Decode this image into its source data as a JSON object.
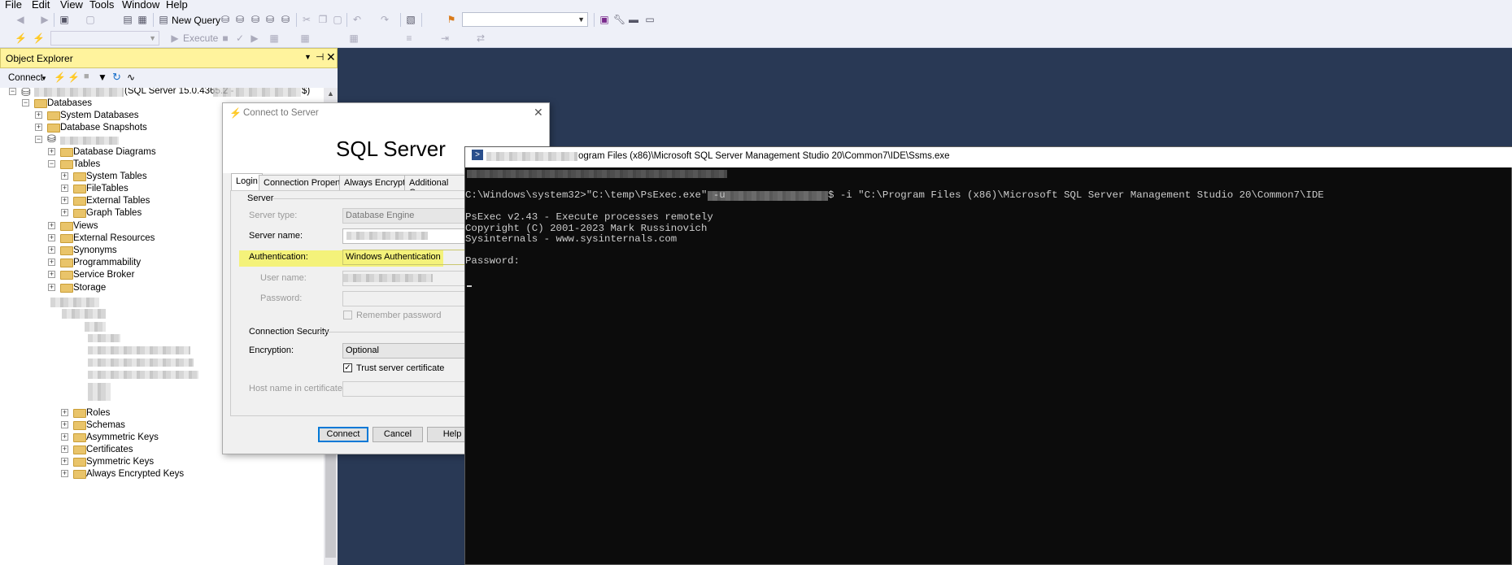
{
  "menu": {
    "file": "File",
    "edit": "Edit",
    "view": "View",
    "tools": "Tools",
    "window": "Window",
    "help": "Help"
  },
  "toolbar": {
    "new_query": "New Query",
    "execute": "Execute"
  },
  "object_explorer": {
    "title": "Object Explorer",
    "connect": "Connect",
    "server_version": "(SQL Server 15.0.4365.2 -",
    "server_suffix": "$)",
    "nodes": {
      "databases": "Databases",
      "system_databases": "System Databases",
      "database_snapshots": "Database Snapshots",
      "database_diagrams": "Database Diagrams",
      "tables": "Tables",
      "system_tables": "System Tables",
      "filetables": "FileTables",
      "external_tables": "External Tables",
      "graph_tables": "Graph Tables",
      "views": "Views",
      "external_resources": "External Resources",
      "synonyms": "Synonyms",
      "programmability": "Programmability",
      "service_broker": "Service Broker",
      "storage": "Storage",
      "roles": "Roles",
      "schemas": "Schemas",
      "asymmetric_keys": "Asymmetric Keys",
      "certificates": "Certificates",
      "symmetric_keys": "Symmetric Keys",
      "always_encrypted_keys": "Always Encrypted Keys"
    }
  },
  "dialog": {
    "title": "Connect to Server",
    "brand": "SQL Server",
    "tabs": [
      "Login",
      "Connection Properties",
      "Always Encrypted",
      "Additional Connec"
    ],
    "server_group": "Server",
    "server_type_label": "Server type:",
    "server_type_value": "Database Engine",
    "server_name_label": "Server name:",
    "auth_label": "Authentication:",
    "auth_value": "Windows Authentication",
    "user_label": "User name:",
    "password_label": "Password:",
    "remember": "Remember password",
    "security_group": "Connection Security",
    "encryption_label": "Encryption:",
    "encryption_value": "Optional",
    "trust": "Trust server certificate",
    "host_label": "Host name in certificate:",
    "connect": "Connect",
    "cancel": "Cancel",
    "help": "Help"
  },
  "console": {
    "title": "ogram Files (x86)\\Microsoft SQL Server Management Studio 20\\Common7\\IDE\\Ssms.exe",
    "cmd_prefix": "C:\\Windows\\system32>\"C:\\temp\\PsExec.exe\" -u ",
    "cmd_suffix": "$ -i \"C:\\Program Files (x86)\\Microsoft SQL Server Management Studio 20\\Common7\\IDE",
    "line1": "PsExec v2.43 - Execute processes remotely",
    "line2": "Copyright (C) 2001-2023 Mark Russinovich",
    "line3": "Sysinternals - www.sysinternals.com",
    "prompt": "Password:"
  },
  "colors": {
    "background": "#293955",
    "oe_header": "#fff39d",
    "highlight": "#f4f27a",
    "console_bg": "#0c0c0c"
  }
}
